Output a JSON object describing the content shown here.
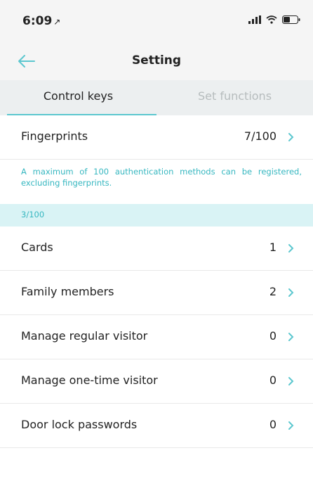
{
  "status_bar": {
    "time": "6:09",
    "location_glyph": "↗"
  },
  "header": {
    "title": "Setting",
    "back_icon": "arrow-left-icon"
  },
  "tabs": [
    {
      "label": "Control keys",
      "active": true
    },
    {
      "label": "Set functions",
      "active": false
    }
  ],
  "fingerprints": {
    "label": "Fingerprints",
    "value": "7/100"
  },
  "notice": {
    "text": "A maximum of 100 authentication methods can be registered, excluding fingerprints.",
    "count": "3/100"
  },
  "items": [
    {
      "label": "Cards",
      "value": "1"
    },
    {
      "label": "Family members",
      "value": "2"
    },
    {
      "label": "Manage regular visitor",
      "value": "0"
    },
    {
      "label": "Manage one-time visitor",
      "value": "0"
    },
    {
      "label": "Door lock passwords",
      "value": "0"
    }
  ],
  "colors": {
    "accent": "#5cc7cf",
    "accent_text": "#36b7c0",
    "band": "#d9f3f5"
  }
}
